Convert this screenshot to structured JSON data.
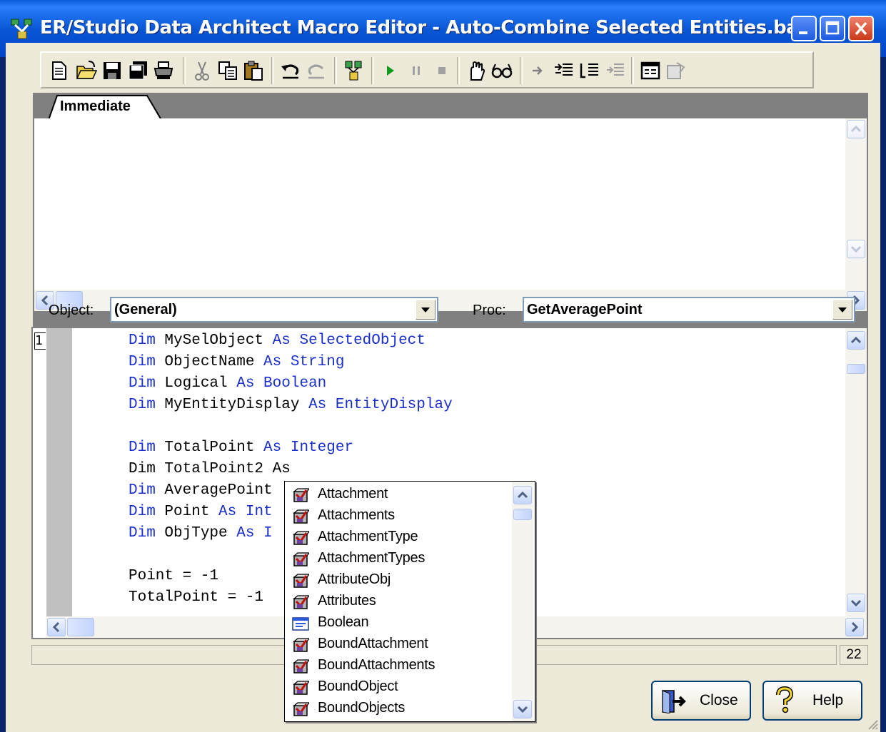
{
  "window": {
    "title": "ER/Studio Data Architect Macro Editor - Auto-Combine Selected Entities.bas"
  },
  "toolbar": {
    "buttons": [
      "new-icon",
      "open-icon",
      "save-icon",
      "save-all-icon",
      "print-icon",
      "cut-icon",
      "copy-icon",
      "paste-icon",
      "undo-icon",
      "redo-icon",
      "references-icon",
      "run-icon",
      "pause-icon",
      "stop-icon",
      "breakpoint-icon",
      "watch-icon",
      "step-into-icon",
      "step-over-icon",
      "step-out-icon",
      "run-to-cursor-icon",
      "dialog-editor-icon",
      "properties-icon"
    ]
  },
  "immediate": {
    "tab_label": "Immediate"
  },
  "selectors": {
    "object_label": "Object:",
    "object_value": "(General)",
    "proc_label": "Proc:",
    "proc_value": "GetAveragePoint"
  },
  "code": {
    "line_number": "1",
    "lines": [
      {
        "parts": [
          [
            "Dim ",
            1
          ],
          [
            "MySelObject ",
            0
          ],
          [
            "As SelectedObject",
            1
          ]
        ]
      },
      {
        "parts": [
          [
            "Dim ",
            1
          ],
          [
            "ObjectName ",
            0
          ],
          [
            "As String",
            1
          ]
        ]
      },
      {
        "parts": [
          [
            "Dim ",
            1
          ],
          [
            "Logical ",
            0
          ],
          [
            "As Boolean",
            1
          ]
        ]
      },
      {
        "parts": [
          [
            "Dim ",
            1
          ],
          [
            "MyEntityDisplay ",
            0
          ],
          [
            "As EntityDisplay",
            1
          ]
        ]
      },
      {
        "parts": []
      },
      {
        "parts": [
          [
            "Dim ",
            1
          ],
          [
            "TotalPoint ",
            0
          ],
          [
            "As Integer",
            1
          ]
        ]
      },
      {
        "parts": [
          [
            "Dim TotalPoint2 As",
            0
          ]
        ]
      },
      {
        "parts": [
          [
            "Dim ",
            1
          ],
          [
            "AveragePoint",
            0
          ]
        ]
      },
      {
        "parts": [
          [
            "Dim ",
            1
          ],
          [
            "Point ",
            0
          ],
          [
            "As Int",
            1
          ]
        ]
      },
      {
        "parts": [
          [
            "Dim ",
            1
          ],
          [
            "ObjType ",
            0
          ],
          [
            "As I",
            1
          ]
        ]
      },
      {
        "parts": []
      },
      {
        "parts": [
          [
            "Point = -1",
            0
          ]
        ]
      },
      {
        "parts": [
          [
            "TotalPoint = -1",
            0
          ]
        ]
      }
    ]
  },
  "autocomplete": {
    "items": [
      {
        "label": "Attachment",
        "icon": "class-icon"
      },
      {
        "label": "Attachments",
        "icon": "class-icon"
      },
      {
        "label": "AttachmentType",
        "icon": "class-icon"
      },
      {
        "label": "AttachmentTypes",
        "icon": "class-icon"
      },
      {
        "label": "AttributeObj",
        "icon": "class-icon"
      },
      {
        "label": "Attributes",
        "icon": "class-icon"
      },
      {
        "label": "Boolean",
        "icon": "type-icon"
      },
      {
        "label": "BoundAttachment",
        "icon": "class-icon"
      },
      {
        "label": "BoundAttachments",
        "icon": "class-icon"
      },
      {
        "label": "BoundObject",
        "icon": "class-icon"
      },
      {
        "label": "BoundObjects",
        "icon": "class-icon"
      }
    ]
  },
  "status": {
    "line_value": "22"
  },
  "buttons": {
    "close_label": "Close",
    "help_label": "Help"
  },
  "colors": {
    "titlebar": "#0a58d6",
    "keyword": "#1a2ecc",
    "face": "#ece9d8"
  }
}
